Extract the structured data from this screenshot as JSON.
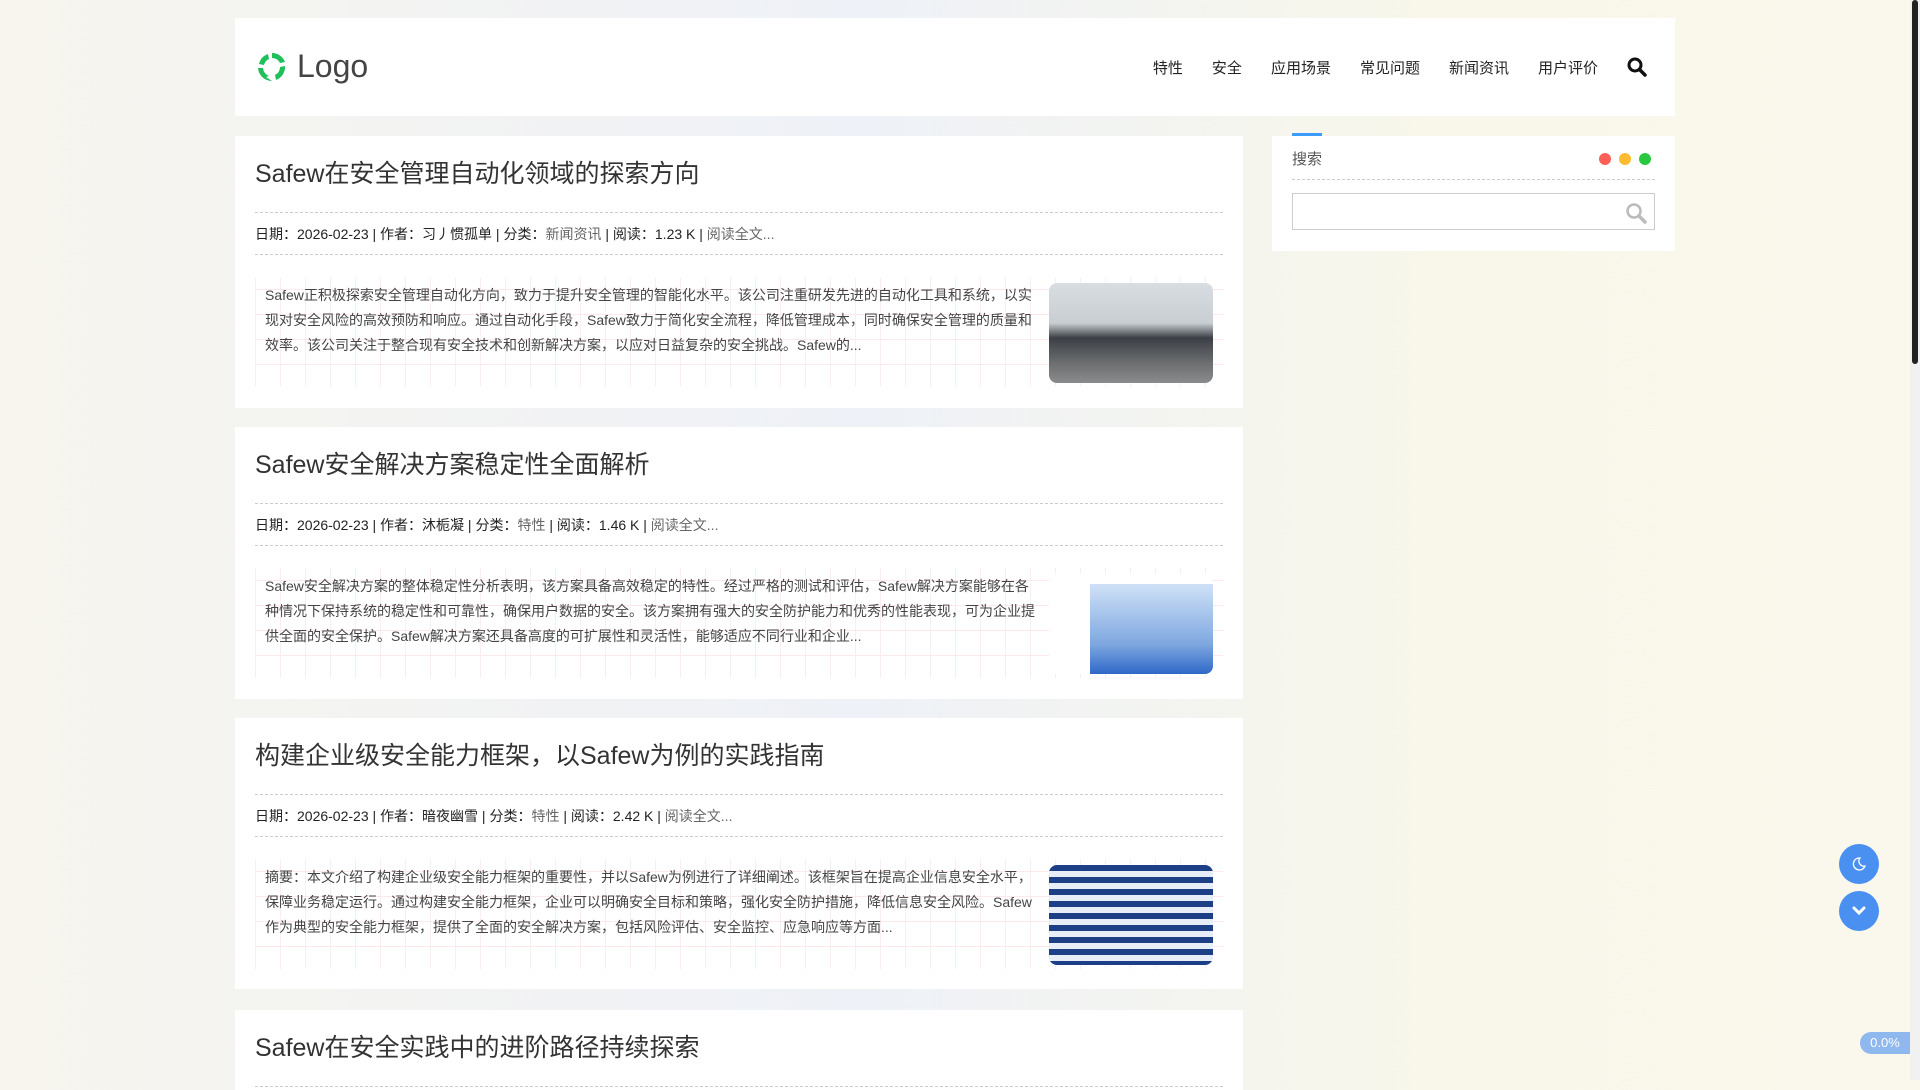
{
  "header": {
    "logo": "Logo",
    "nav": [
      "特性",
      "安全",
      "应用场景",
      "常见问题",
      "新闻资讯",
      "用户评价"
    ]
  },
  "posts": [
    {
      "title": "Safew在安全管理自动化领域的探索方向",
      "date_label": "日期：",
      "date": "2026-02-23",
      "author_label": "作者：",
      "author": "习丿惯孤单",
      "category_label": "分类：",
      "category": "新闻资讯",
      "reads_label": "阅读：",
      "reads": "1.23 K",
      "read_more": "阅读全文...",
      "excerpt": "Safew正积极探索安全管理自动化方向，致力于提升安全管理的智能化水平。该公司注重研发先进的自动化工具和系统，以实现对安全风险的高效预防和响应。通过自动化手段，Safew致力于简化安全流程，降低管理成本，同时确保安全管理的质量和效率。该公司关注于整合现有安全技术和创新解决方案，以应对日益复杂的安全挑战。Safew的..."
    },
    {
      "title": "Safew安全解决方案稳定性全面解析",
      "date_label": "日期：",
      "date": "2026-02-23",
      "author_label": "作者：",
      "author": "沐栀凝",
      "category_label": "分类：",
      "category": "特性",
      "reads_label": "阅读：",
      "reads": "1.46 K",
      "read_more": "阅读全文...",
      "excerpt": "Safew安全解决方案的整体稳定性分析表明，该方案具备高效稳定的特性。经过严格的测试和评估，Safew解决方案能够在各种情况下保持系统的稳定性和可靠性，确保用户数据的安全。该方案拥有强大的安全防护能力和优秀的性能表现，可为企业提供全面的安全保护。Safew解决方案还具备高度的可扩展性和灵活性，能够适应不同行业和企业..."
    },
    {
      "title": "构建企业级安全能力框架，以Safew为例的实践指南",
      "date_label": "日期：",
      "date": "2026-02-23",
      "author_label": "作者：",
      "author": "暗夜幽雪",
      "category_label": "分类：",
      "category": "特性",
      "reads_label": "阅读：",
      "reads": "2.42 K",
      "read_more": "阅读全文...",
      "excerpt": "摘要：本文介绍了构建企业级安全能力框架的重要性，并以Safew为例进行了详细阐述。该框架旨在提高企业信息安全水平，保障业务稳定运行。通过构建安全能力框架，企业可以明确安全目标和策略，强化安全防护措施，降低信息安全风险。Safew作为典型的安全能力框架，提供了全面的安全解决方案，包括风险评估、安全监控、应急响应等方面..."
    },
    {
      "title": "Safew在安全实践中的进阶路径持续探索"
    }
  ],
  "sidebar": {
    "title": "搜索",
    "search_placeholder": "",
    "dot_colors": [
      "#ff5f57",
      "#febc2e",
      "#28c840"
    ]
  },
  "progress": "0.0%",
  "colors": {
    "accent": "#3d9bff",
    "button": "#4a90f0",
    "logo": "#1fbf5a"
  }
}
